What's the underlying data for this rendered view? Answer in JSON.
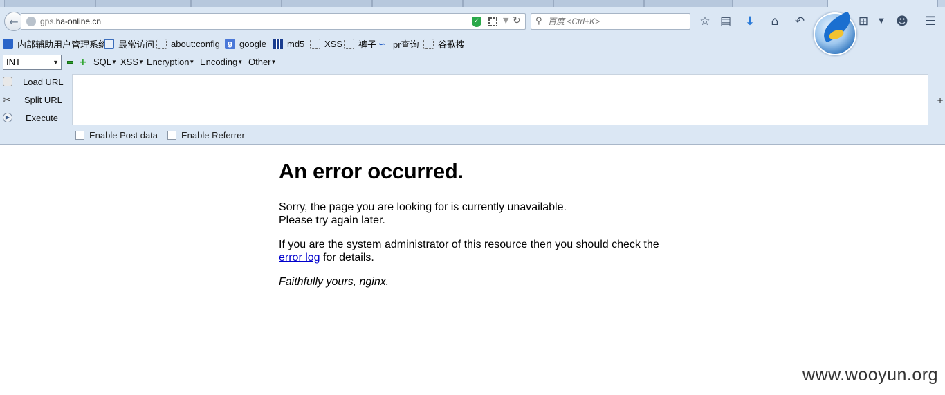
{
  "browser": {
    "url_prefix": "gps.",
    "url_domain": "ha-online.cn",
    "search_placeholder": "百度 <Ctrl+K>"
  },
  "bookmarks": [
    {
      "label": "内部辅助用户管理系统",
      "icon": "user-system-icon"
    },
    {
      "label": "最常访问",
      "icon": "magnifier-icon"
    },
    {
      "label": "about:config",
      "icon": "blank-page-icon"
    },
    {
      "label": "google",
      "icon": "google-icon"
    },
    {
      "label": "md5",
      "icon": "grid-icon"
    },
    {
      "label": "XSS",
      "icon": "blank-page-icon"
    },
    {
      "label": "裤子",
      "icon": "blank-page-icon"
    },
    {
      "label": "pr查询",
      "icon": "pr-icon"
    },
    {
      "label": "谷歌搜",
      "icon": "blank-page-icon"
    }
  ],
  "hackbar": {
    "select_value": "INT",
    "menus": [
      "SQL",
      "XSS",
      "Encryption",
      "Encoding",
      "Other"
    ],
    "load_url": {
      "prefix": "Lo",
      "accel": "a",
      "rest": "d URL"
    },
    "split_url": {
      "accel": "S",
      "rest": "plit URL"
    },
    "execute": {
      "prefix": "E",
      "accel": "x",
      "rest": "ecute"
    },
    "enable_post": "Enable Post data",
    "enable_referrer": "Enable Referrer",
    "side_minus": "-",
    "side_plus": "+"
  },
  "page": {
    "title": "An error occurred.",
    "line1": "Sorry, the page you are looking for is currently unavailable.",
    "line2": "Please try again later.",
    "admin_text": "If you are the system administrator of this resource then you should check the",
    "error_link": "error log",
    "admin_tail": " for details.",
    "signature": "Faithfully yours, nginx."
  },
  "watermark": "www.wooyun.org"
}
